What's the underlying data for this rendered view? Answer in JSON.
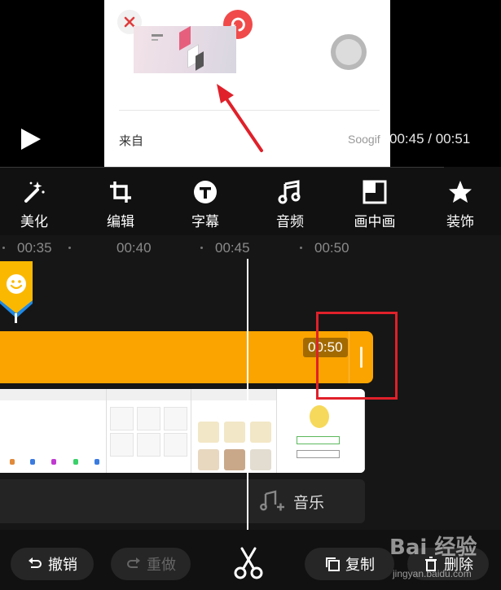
{
  "preview": {
    "time_readout": "00:45 / 00:51",
    "play_icon": "play-icon"
  },
  "share_card": {
    "close_icon": "close-icon",
    "refresh_icon": "refresh-icon",
    "from_label": "来自",
    "source_label": "Soogif"
  },
  "toolbar": {
    "items": [
      {
        "label": "美化",
        "icon": "magic-wand-icon"
      },
      {
        "label": "编辑",
        "icon": "crop-icon"
      },
      {
        "label": "字幕",
        "icon": "text-icon"
      },
      {
        "label": "音频",
        "icon": "music-note-icon"
      },
      {
        "label": "画中画",
        "icon": "picture-in-picture-icon"
      },
      {
        "label": "装饰",
        "icon": "star-icon"
      }
    ]
  },
  "timeline": {
    "ticks": [
      "00:35",
      "00:40",
      "00:45",
      "00:50"
    ],
    "track_end_time": "00:50",
    "music_label": "音乐",
    "colors": {
      "track": "#fba400",
      "highlight": "#e0202a",
      "playhead": "#ffffff"
    }
  },
  "actions": {
    "undo": "撤销",
    "redo": "重做",
    "copy": "复制",
    "delete": "删除"
  },
  "watermark": {
    "logo": "Bai 经验",
    "url": "jingyan.baidu.com"
  }
}
